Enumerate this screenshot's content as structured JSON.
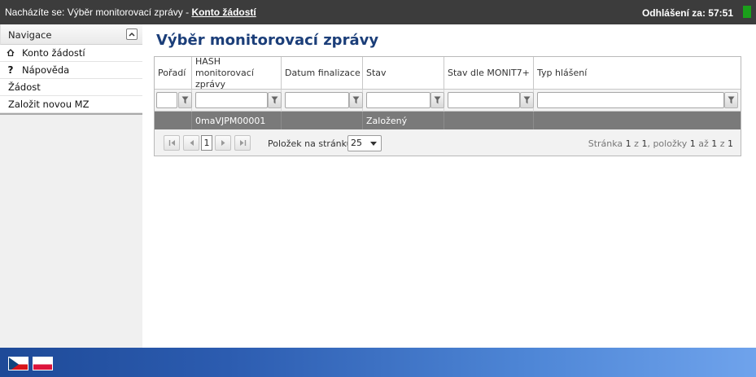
{
  "topbar": {
    "crumb_prefix": "Nacházíte se: Výběr monitorovací zprávy - ",
    "crumb_link": "Konto žádostí",
    "logout_text": "Odhlášení za:  57:51",
    "status_color": "#1aa01a"
  },
  "sidebar": {
    "header": "Navigace",
    "items": [
      {
        "label": "Konto žádostí",
        "icon": "home-icon"
      },
      {
        "label": "Nápověda",
        "icon": "help-icon"
      },
      {
        "label": "Žádost"
      },
      {
        "label": "Založit novou MZ"
      }
    ]
  },
  "main": {
    "title": "Výběr monitorovací zprávy",
    "columns": [
      "Pořadí",
      "HASH monitorovací zprávy",
      "Datum finalizace",
      "Stav",
      "Stav dle MONIT7+",
      "Typ hlášení"
    ],
    "rows": [
      [
        "",
        "0maVJPM00001",
        "",
        "Založený",
        "",
        ""
      ]
    ],
    "pager": {
      "current_page": "1",
      "items_per_page_label": "Položek na stránku",
      "items_per_page": "25",
      "info_prefix": "Stránka ",
      "page": "1",
      "of": " z ",
      "pages": "1",
      "items_label": ", položky ",
      "from": "1",
      "to_label": " až ",
      "to": "1",
      "total_label": " z ",
      "total": "1"
    }
  },
  "footer": {
    "flags": [
      "czech-flag-icon",
      "polish-flag-icon"
    ]
  },
  "colors": {
    "title": "#1b3e79",
    "topbar": "#3c3c3c",
    "selected_row": "#7a7a7a",
    "footer": "#2c5cb0"
  }
}
